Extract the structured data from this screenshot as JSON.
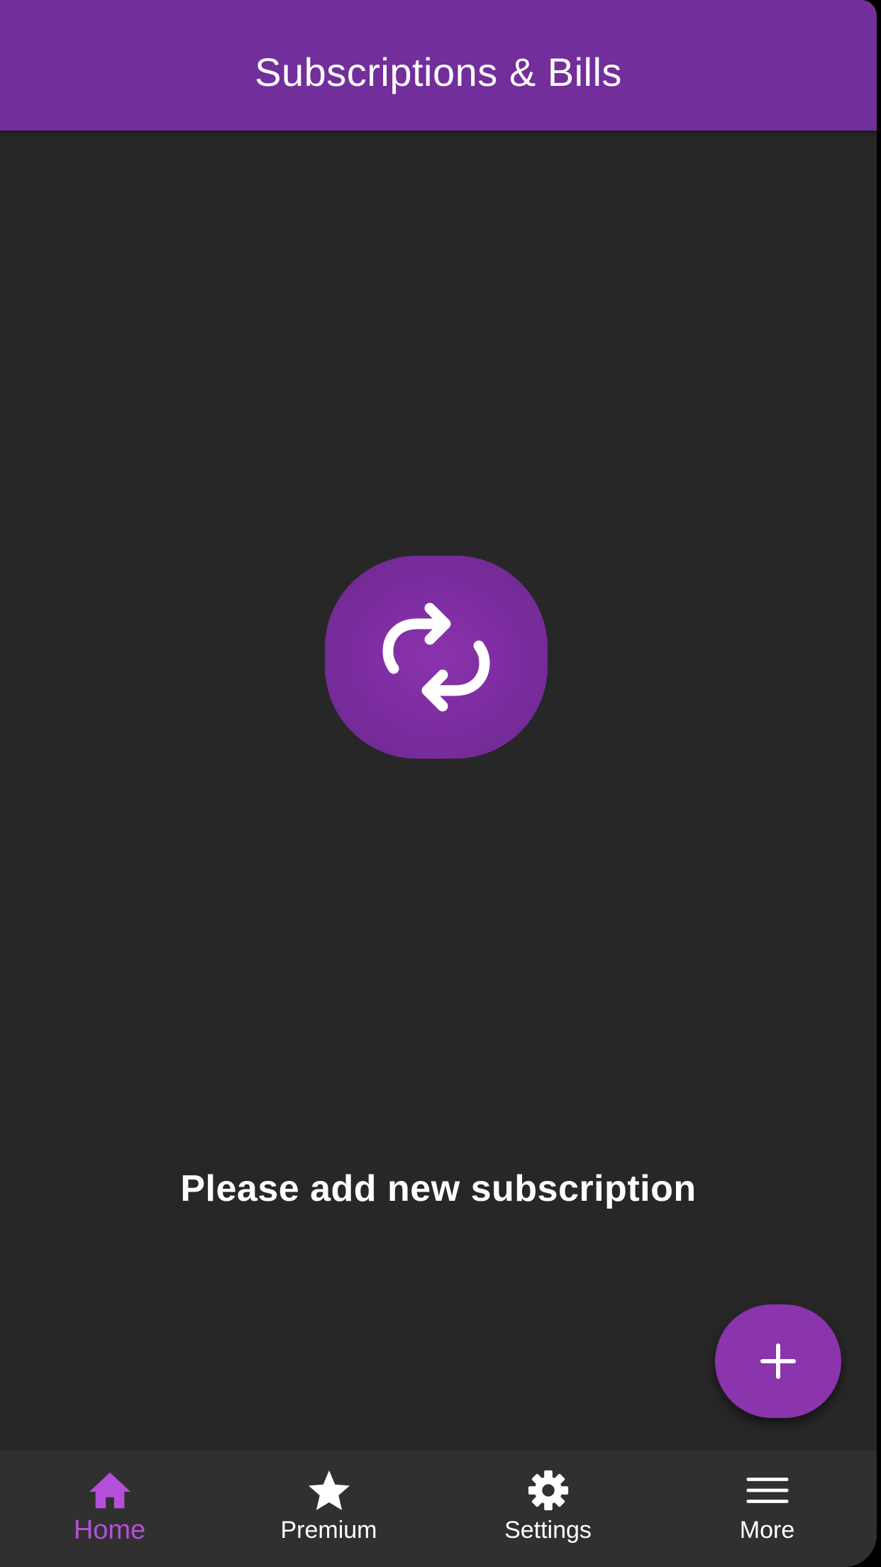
{
  "header": {
    "title": "Subscriptions & Bills"
  },
  "empty_state": {
    "icon": "repeat-icon",
    "message": "Please add new subscription"
  },
  "fab": {
    "icon": "plus-icon"
  },
  "bottom_nav": {
    "active": "Home",
    "items": [
      {
        "label": "Home",
        "icon": "home-icon"
      },
      {
        "label": "Premium",
        "icon": "star-icon"
      },
      {
        "label": "Settings",
        "icon": "gear-icon"
      },
      {
        "label": "More",
        "icon": "menu-icon"
      }
    ]
  },
  "colors": {
    "app_bar": "#722e9b",
    "background": "#282728",
    "accent": "#8a34ad",
    "active_nav": "#b64fd8",
    "nav_background": "#303030",
    "text": "#ffffff"
  }
}
